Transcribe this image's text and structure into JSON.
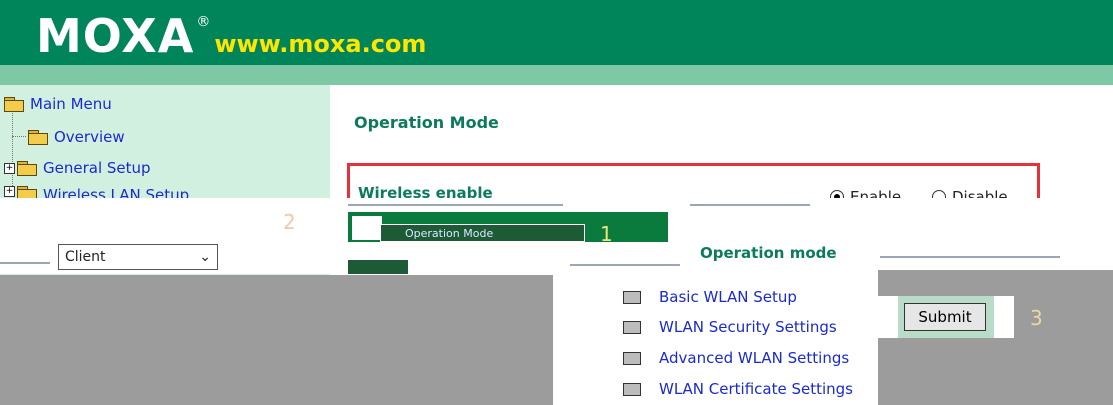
{
  "header": {
    "logo_text": "MOXA",
    "registered": "®",
    "url": "www.moxa.com",
    "colors": {
      "header_bg": "#00845a",
      "header_band": "#7fc8a6",
      "url_color": "#ffe600"
    }
  },
  "menu": {
    "items": [
      {
        "label": "Main Menu",
        "icon": "folder-open-icon"
      },
      {
        "label": "Overview",
        "icon": "folder-icon"
      },
      {
        "label": "General Setup",
        "icon": "folder-icon",
        "expandable": true
      },
      {
        "label": "Wireless LAN Setup",
        "icon": "folder-icon",
        "expandable": true
      }
    ],
    "submenu": [
      {
        "label": "Basic WLAN Setup"
      },
      {
        "label": "WLAN Security Settings"
      },
      {
        "label": "Advanced WLAN Settings"
      },
      {
        "label": "WLAN Certificate Settings"
      }
    ],
    "operation_mode_item": "Operation Mode"
  },
  "main": {
    "title": "Operation Mode",
    "wireless_enable_label": "Wireless enable",
    "enable_label": "Enable",
    "disable_label": "Disable",
    "wireless_enable_value": "Enable",
    "operation_mode_label": "Operation mode",
    "operation_mode_value": "Client",
    "submit_label": "Submit"
  },
  "annotations": {
    "one": "1",
    "two": "2",
    "three": "3"
  }
}
